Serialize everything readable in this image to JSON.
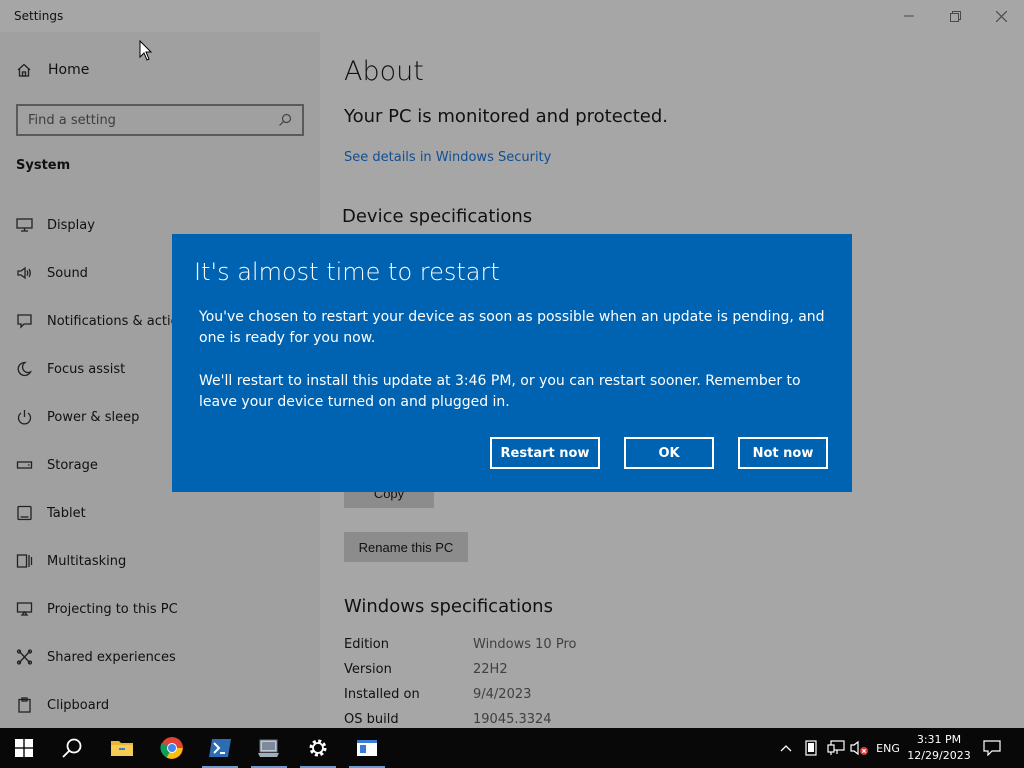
{
  "window": {
    "title": "Settings"
  },
  "sidebar": {
    "home_label": "Home",
    "search_placeholder": "Find a setting",
    "section_label": "System",
    "items": [
      {
        "label": "Display",
        "icon": "display-icon"
      },
      {
        "label": "Sound",
        "icon": "sound-icon"
      },
      {
        "label": "Notifications & actions",
        "icon": "notifications-icon"
      },
      {
        "label": "Focus assist",
        "icon": "moon-icon"
      },
      {
        "label": "Power & sleep",
        "icon": "power-icon"
      },
      {
        "label": "Storage",
        "icon": "storage-icon"
      },
      {
        "label": "Tablet",
        "icon": "tablet-icon"
      },
      {
        "label": "Multitasking",
        "icon": "multitasking-icon"
      },
      {
        "label": "Projecting to this PC",
        "icon": "projecting-icon"
      },
      {
        "label": "Shared experiences",
        "icon": "shared-experiences-icon"
      },
      {
        "label": "Clipboard",
        "icon": "clipboard-icon"
      }
    ]
  },
  "main": {
    "title": "About",
    "protection_status": "Your PC is monitored and protected.",
    "security_link": "See details in Windows Security",
    "device_specs_heading": "Device specifications",
    "copy_button": "Copy",
    "rename_button": "Rename this PC",
    "windows_specs_heading": "Windows specifications",
    "specs": [
      {
        "key": "Edition",
        "value": "Windows 10 Pro"
      },
      {
        "key": "Version",
        "value": "22H2"
      },
      {
        "key": "Installed on",
        "value": "9/4/2023"
      },
      {
        "key": "OS build",
        "value": "19045.3324"
      }
    ]
  },
  "dialog": {
    "title": "It's almost time to restart",
    "paragraph1": "You've chosen to restart your device as soon as possible when an update is pending, and one is ready for you now.",
    "paragraph2": "We'll restart to install this update at 3:46 PM, or you can restart sooner. Remember to leave your device turned on and plugged in.",
    "restart_now": "Restart now",
    "ok": "OK",
    "not_now": "Not now",
    "background_color": "#0063b1"
  },
  "taskbar": {
    "language": "ENG",
    "time": "3:31 PM",
    "date": "12/29/2023"
  }
}
